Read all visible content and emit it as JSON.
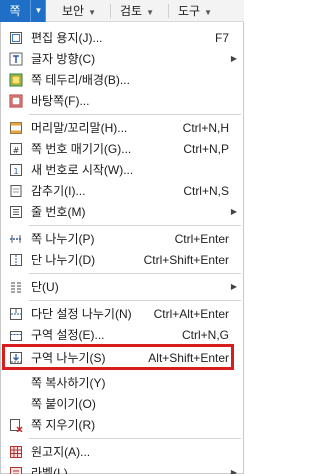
{
  "menubar": {
    "active": "쪽",
    "items": [
      "보안",
      "검토",
      "도구"
    ]
  },
  "menu": {
    "items": [
      {
        "label": "편집 용지(J)...",
        "shortcut": "F7",
        "icon": "page-setup-icon"
      },
      {
        "label": "글자 방향(C)",
        "shortcut": "",
        "icon": "text-direction-icon",
        "submenu": true
      },
      {
        "label": "쪽 테두리/배경(B)...",
        "shortcut": "",
        "icon": "page-border-icon"
      },
      {
        "label": "바탕쪽(F)...",
        "shortcut": "",
        "icon": "master-page-icon"
      },
      {
        "label": "머리말/꼬리말(H)...",
        "shortcut": "Ctrl+N,H",
        "icon": "header-footer-icon"
      },
      {
        "label": "쪽 번호 매기기(G)...",
        "shortcut": "Ctrl+N,P",
        "icon": "page-number-icon"
      },
      {
        "label": "새 번호로 시작(W)...",
        "shortcut": "",
        "icon": "new-number-icon"
      },
      {
        "label": "감추기(I)...",
        "shortcut": "Ctrl+N,S",
        "icon": "hide-icon"
      },
      {
        "label": "줄 번호(M)",
        "shortcut": "",
        "icon": "line-number-icon",
        "submenu": true
      },
      {
        "label": "쪽 나누기(P)",
        "shortcut": "Ctrl+Enter",
        "icon": "page-break-icon"
      },
      {
        "label": "단 나누기(D)",
        "shortcut": "Ctrl+Shift+Enter",
        "icon": "column-break-icon"
      },
      {
        "label": "단(U)",
        "shortcut": "",
        "icon": "columns-icon",
        "submenu": true
      },
      {
        "label": "다단 설정 나누기(N)",
        "shortcut": "Ctrl+Alt+Enter",
        "icon": "multi-column-break-icon"
      },
      {
        "label": "구역 설정(E)...",
        "shortcut": "Ctrl+N,G",
        "icon": "section-setup-icon"
      },
      {
        "label": "구역 나누기(S)",
        "shortcut": "Alt+Shift+Enter",
        "icon": "section-break-icon"
      },
      {
        "label": "쪽 복사하기(Y)",
        "shortcut": "",
        "icon": ""
      },
      {
        "label": "쪽 붙이기(O)",
        "shortcut": "",
        "icon": ""
      },
      {
        "label": "쪽 지우기(R)",
        "shortcut": "",
        "icon": "delete-page-icon"
      },
      {
        "label": "원고지(A)...",
        "shortcut": "",
        "icon": "manuscript-icon"
      },
      {
        "label": "라벨(L)",
        "shortcut": "",
        "icon": "label-icon",
        "submenu": true
      }
    ]
  },
  "colors": {
    "accent": "#1f6fc6",
    "highlight_border": "#d81d1d"
  }
}
